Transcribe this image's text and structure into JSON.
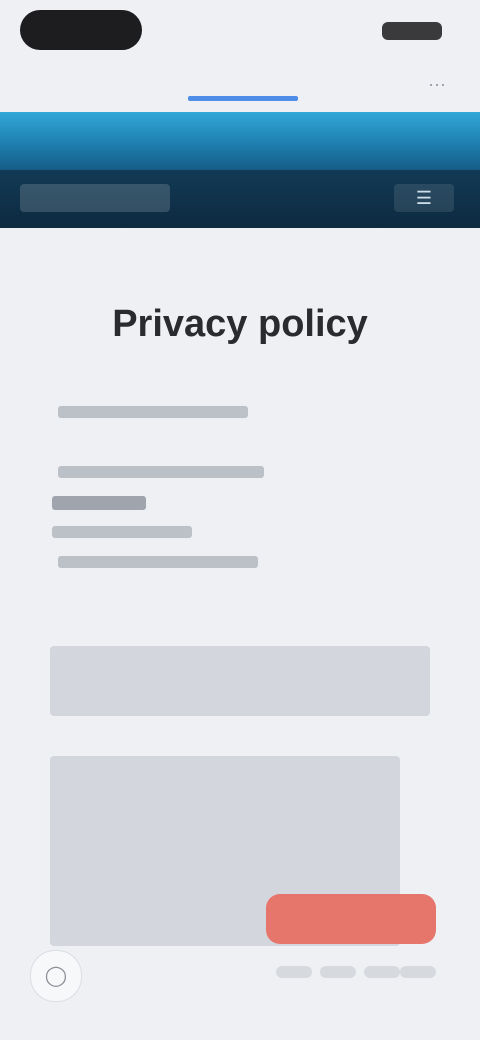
{
  "browser": {
    "url": "",
    "action_icon": "share-icon"
  },
  "site": {
    "nav_label": "",
    "menu_icon": "menu-icon"
  },
  "page": {
    "title": "Privacy policy"
  },
  "footer": {
    "cta_label": "",
    "round_icon": "chat-icon"
  },
  "colors": {
    "header_top": "#31a8d8",
    "header_bottom": "#155c86",
    "nav_bg": "#0d2a40",
    "cta": "#e6756c",
    "link": "#2f6fd6"
  }
}
